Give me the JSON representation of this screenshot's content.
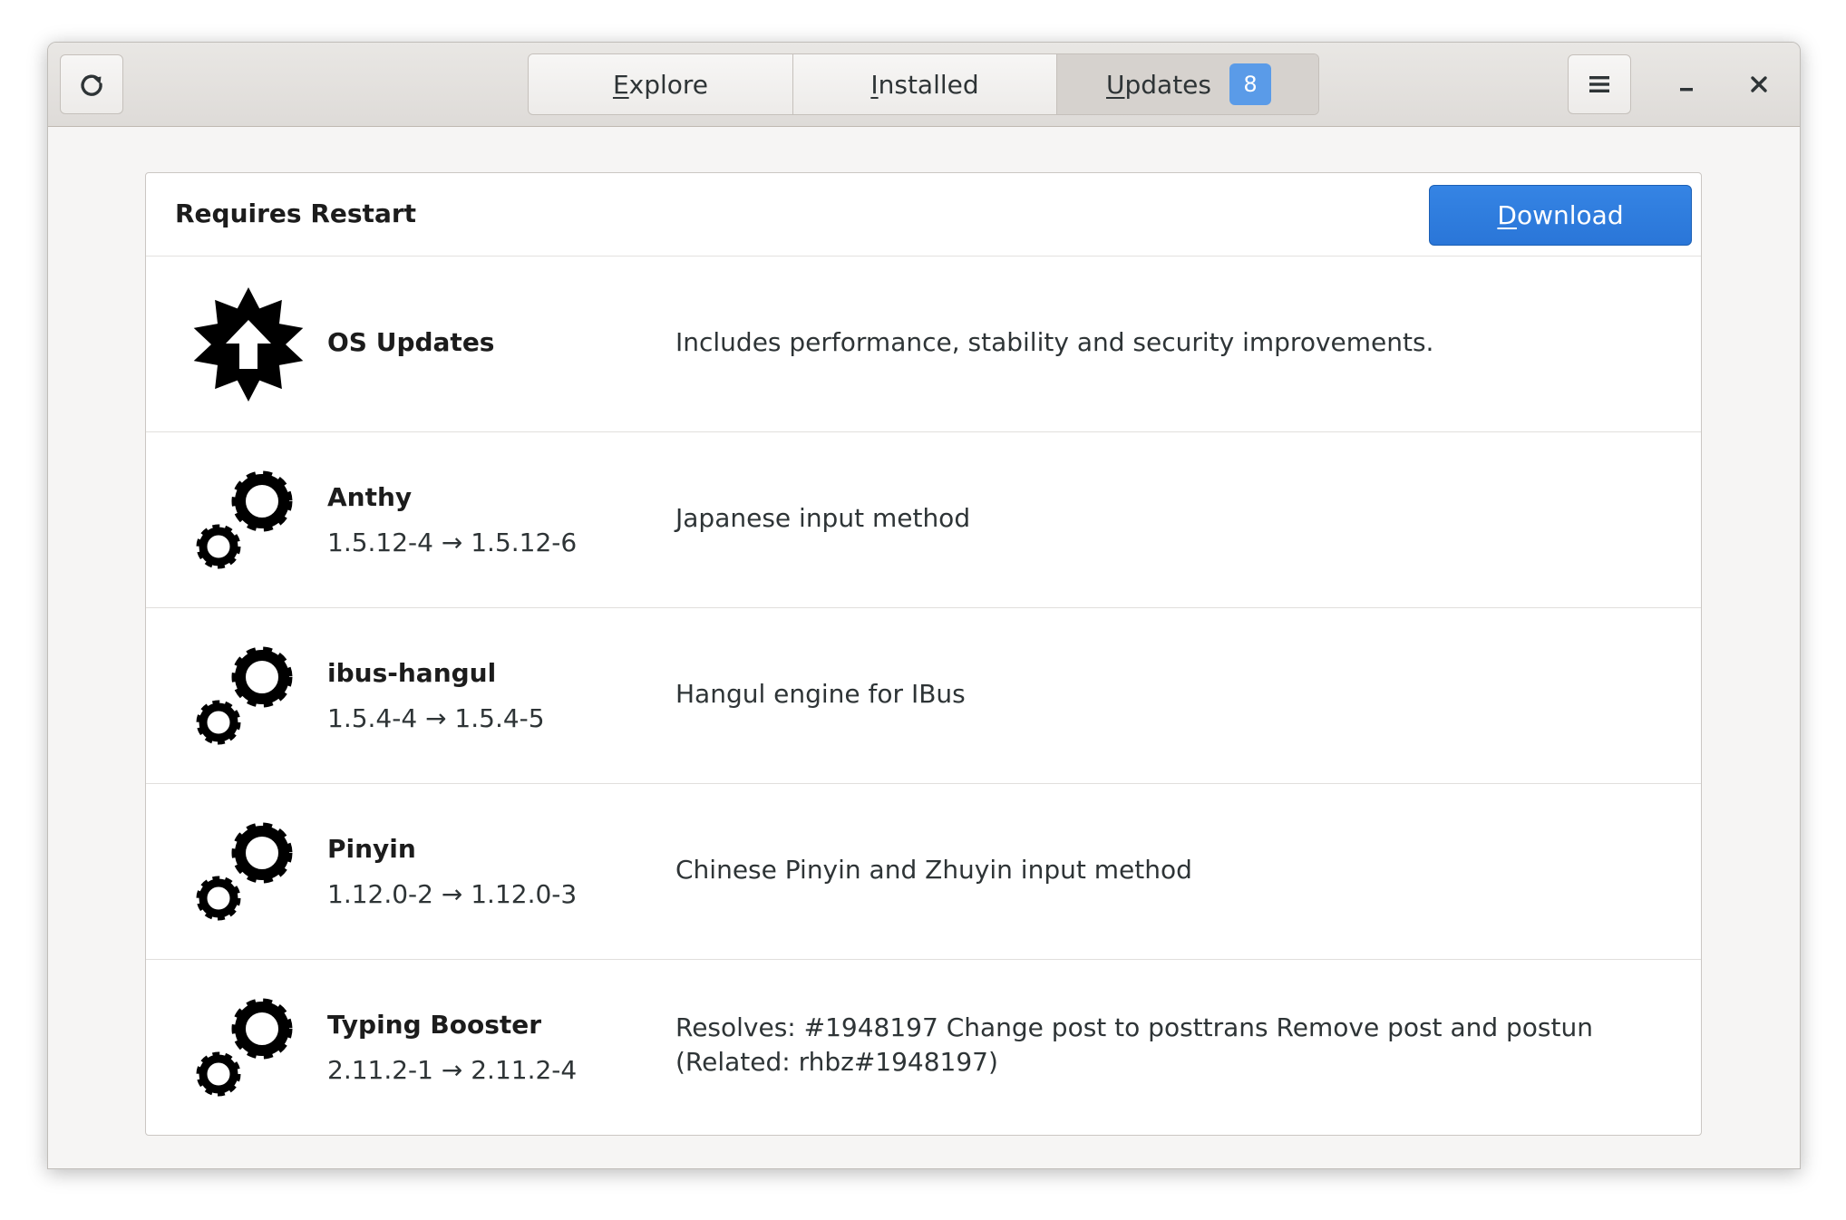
{
  "header": {
    "tabs": [
      {
        "label_first": "E",
        "label_rest": "xplore"
      },
      {
        "label_first": "I",
        "label_rest": "nstalled"
      },
      {
        "label_first": "U",
        "label_rest": "pdates",
        "badge": "8"
      }
    ]
  },
  "section": {
    "title": "Requires Restart",
    "download_first": "D",
    "download_rest": "ownload"
  },
  "updates": [
    {
      "name": "OS Updates",
      "version": "",
      "description": "Includes performance, stability and security improvements.",
      "icon": "os-update-icon"
    },
    {
      "name": "Anthy",
      "version": "1.5.12-4 → 1.5.12-6",
      "description": "Japanese input method",
      "icon": "gears-icon"
    },
    {
      "name": "ibus-hangul",
      "version": "1.5.4-4 → 1.5.4-5",
      "description": "Hangul engine for IBus",
      "icon": "gears-icon"
    },
    {
      "name": "Pinyin",
      "version": "1.12.0-2 → 1.12.0-3",
      "description": "Chinese Pinyin and Zhuyin input method",
      "icon": "gears-icon"
    },
    {
      "name": "Typing Booster",
      "version": "2.11.2-1 → 2.11.2-4",
      "description": "Resolves: #1948197 Change post to posttrans Remove post and postun (Related: rhbz#1948197)",
      "icon": "gears-icon"
    }
  ]
}
